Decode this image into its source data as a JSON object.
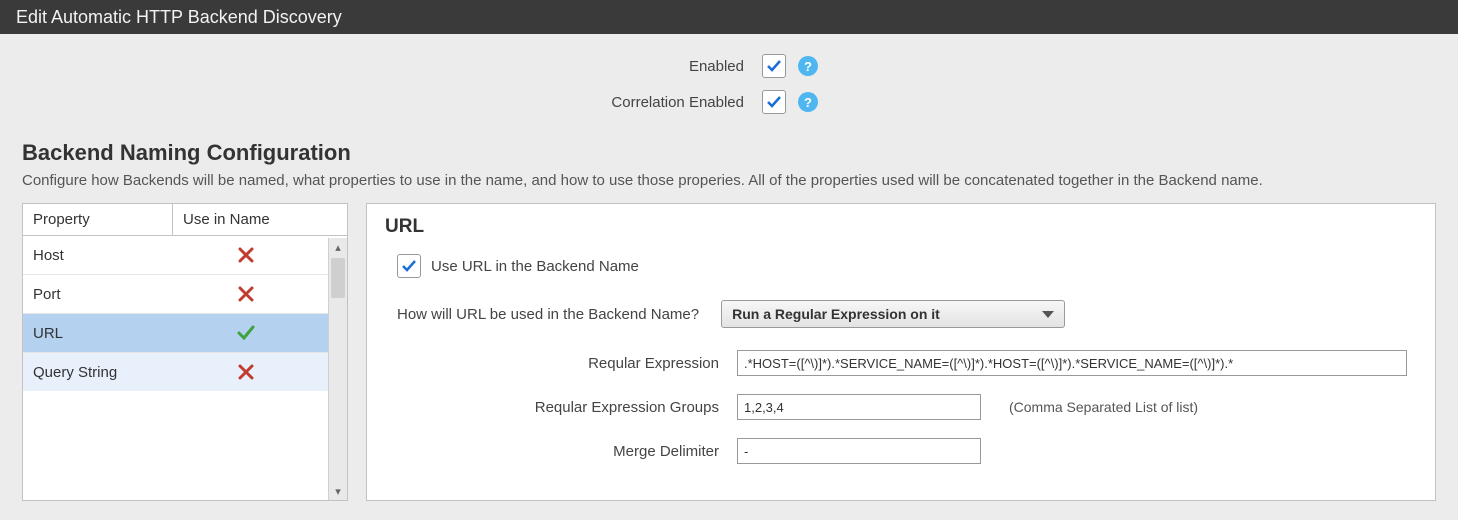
{
  "title": "Edit Automatic HTTP Backend Discovery",
  "toggles": {
    "enabled_label": "Enabled",
    "correlation_label": "Correlation Enabled"
  },
  "section": {
    "heading": "Backend Naming Configuration",
    "description": "Configure how Backends will be named, what properties to use in the name, and how to use those properies.  All of the properties used will be concatenated together in the Backend name."
  },
  "prop_table": {
    "col_property": "Property",
    "col_use": "Use in Name",
    "rows": [
      {
        "name": "Host",
        "used": false
      },
      {
        "name": "Port",
        "used": false
      },
      {
        "name": "URL",
        "used": true
      },
      {
        "name": "Query String",
        "used": false
      }
    ]
  },
  "detail": {
    "title": "URL",
    "use_label": "Use URL in the Backend Name",
    "how_label": "How will URL be used in the Backend Name?",
    "dropdown_value": "Run a Regular Expression on it",
    "regex_label": "Reqular Expression",
    "regex_value": ".*HOST=([^\\)]*).*SERVICE_NAME=([^\\)]*).*HOST=([^\\)]*).*SERVICE_NAME=([^\\)]*).*",
    "groups_label": "Reqular Expression Groups",
    "groups_value": "1,2,3,4",
    "groups_hint": "(Comma Separated List of list)",
    "merge_label": "Merge Delimiter",
    "merge_value": "-"
  }
}
